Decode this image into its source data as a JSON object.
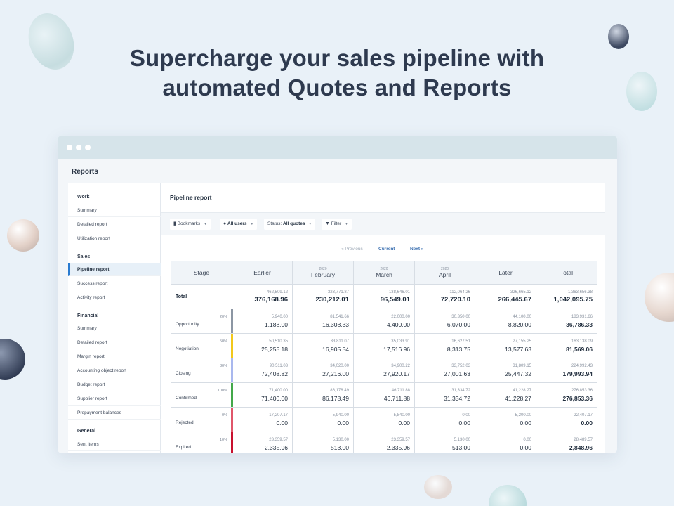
{
  "headline": {
    "line1": "Supercharge your sales pipeline with",
    "line2": "automated Quotes and Reports"
  },
  "window": {
    "page_title": "Reports"
  },
  "sidebar": {
    "sections": [
      {
        "heading": "Work",
        "items": [
          "Summary",
          "Detailed report",
          "Utilization report"
        ]
      },
      {
        "heading": "Sales",
        "items": [
          "Pipeline report",
          "Success report",
          "Activity report"
        ]
      },
      {
        "heading": "Financial",
        "items": [
          "Summary",
          "Detailed report",
          "Margin report",
          "Accounting object report",
          "Budget report",
          "Supplier report",
          "Prepayment balances"
        ]
      },
      {
        "heading": "General",
        "items": [
          "Sent items"
        ]
      }
    ],
    "active_item": "Pipeline report"
  },
  "main": {
    "title": "Pipeline report",
    "toolbar": {
      "bookmarks": "Bookmarks",
      "users": "All users",
      "status_label": "Status:",
      "status_value": "All quotes",
      "filter": "Filter"
    },
    "pager": {
      "previous": "« Previous",
      "current": "Current",
      "next": "Next »"
    }
  },
  "table": {
    "headers": [
      {
        "label": "Stage",
        "year": ""
      },
      {
        "label": "Earlier",
        "year": ""
      },
      {
        "label": "February",
        "year": "2020"
      },
      {
        "label": "March",
        "year": "2020"
      },
      {
        "label": "April",
        "year": "2020"
      },
      {
        "label": "Later",
        "year": ""
      },
      {
        "label": "Total",
        "year": ""
      }
    ],
    "total_row": {
      "label": "Total",
      "cells": [
        {
          "sub": "462,509.12",
          "main": "376,168.96"
        },
        {
          "sub": "323,771.87",
          "main": "230,212.01"
        },
        {
          "sub": "138,646.01",
          "main": "96,549.01"
        },
        {
          "sub": "112,064.26",
          "main": "72,720.10"
        },
        {
          "sub": "326,665.12",
          "main": "266,445.67"
        },
        {
          "sub": "1,363,656.38",
          "main": "1,042,095.75"
        }
      ]
    },
    "rows": [
      {
        "stage": "Opportunity",
        "pct": "20%",
        "color": "#8c96a3",
        "cells": [
          {
            "sub": "5,940.00",
            "main": "1,188.00"
          },
          {
            "sub": "81,541.66",
            "main": "16,308.33"
          },
          {
            "sub": "22,000.00",
            "main": "4,400.00"
          },
          {
            "sub": "30,350.00",
            "main": "6,070.00"
          },
          {
            "sub": "44,100.00",
            "main": "8,820.00"
          },
          {
            "sub": "183,931.66",
            "main": "36,786.33"
          }
        ]
      },
      {
        "stage": "Negotiation",
        "pct": "50%",
        "color": "#f2c81b",
        "cells": [
          {
            "sub": "50,510.35",
            "main": "25,255.18"
          },
          {
            "sub": "33,811.07",
            "main": "16,905.54"
          },
          {
            "sub": "35,033.91",
            "main": "17,516.96"
          },
          {
            "sub": "16,627.51",
            "main": "8,313.75"
          },
          {
            "sub": "27,155.25",
            "main": "13,577.63"
          },
          {
            "sub": "163,138.09",
            "main": "81,569.06"
          }
        ]
      },
      {
        "stage": "Closing",
        "pct": "80%",
        "color": "#a9b8ee",
        "cells": [
          {
            "sub": "90,511.03",
            "main": "72,408.82"
          },
          {
            "sub": "34,020.00",
            "main": "27,216.00"
          },
          {
            "sub": "34,900.22",
            "main": "27,920.17"
          },
          {
            "sub": "33,752.03",
            "main": "27,001.63"
          },
          {
            "sub": "31,809.15",
            "main": "25,447.32"
          },
          {
            "sub": "224,992.43",
            "main": "179,993.94"
          }
        ]
      },
      {
        "stage": "Confirmed",
        "pct": "100%",
        "color": "#43a84a",
        "cells": [
          {
            "sub": "71,400.00",
            "main": "71,400.00"
          },
          {
            "sub": "86,178.49",
            "main": "86,178.49"
          },
          {
            "sub": "46,711.88",
            "main": "46,711.88"
          },
          {
            "sub": "31,334.72",
            "main": "31,334.72"
          },
          {
            "sub": "41,228.27",
            "main": "41,228.27"
          },
          {
            "sub": "276,853.36",
            "main": "276,853.36"
          }
        ]
      },
      {
        "stage": "Rejected",
        "pct": "0%",
        "color": "#e0566a",
        "cells": [
          {
            "sub": "17,207.17",
            "main": "0.00"
          },
          {
            "sub": "5,940.00",
            "main": "0.00"
          },
          {
            "sub": "5,840.00",
            "main": "0.00"
          },
          {
            "sub": "0.00",
            "main": "0.00"
          },
          {
            "sub": "5,200.00",
            "main": "0.00"
          },
          {
            "sub": "22,407.17",
            "main": "0.00"
          }
        ]
      },
      {
        "stage": "Expired",
        "pct": "10%",
        "color": "#c8102e",
        "cells": [
          {
            "sub": "23,359.57",
            "main": "2,335.96"
          },
          {
            "sub": "5,130.00",
            "main": "513.00"
          },
          {
            "sub": "23,359.57",
            "main": "2,335.96"
          },
          {
            "sub": "5,130.00",
            "main": "513.00"
          },
          {
            "sub": "0.00",
            "main": "0.00"
          },
          {
            "sub": "28,489.57",
            "main": "2,848.96"
          }
        ]
      }
    ]
  },
  "colors": {
    "background": "#e9f1f8",
    "titlebar": "#d6e4ea",
    "accent": "#2a7bd0",
    "headline": "#2e3a4f"
  }
}
